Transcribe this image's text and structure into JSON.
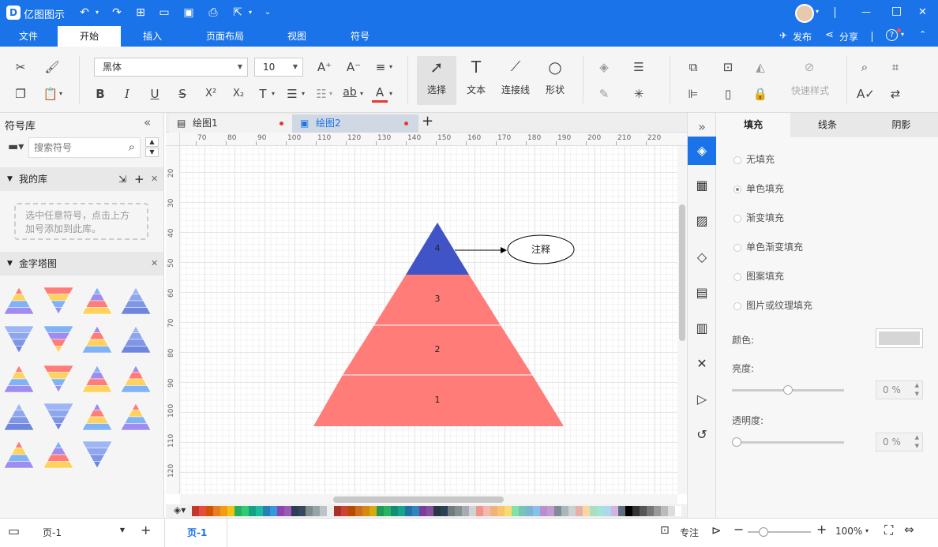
{
  "app": {
    "title": "亿图图示"
  },
  "title_actions": {
    "minimize": "—",
    "maximize": "□",
    "close": "✕"
  },
  "menu": {
    "tabs": [
      "文件",
      "开始",
      "插入",
      "页面布局",
      "视图",
      "符号"
    ],
    "active": 1,
    "publish": "发布",
    "share": "分享"
  },
  "ribbon": {
    "font_family": "黑体",
    "font_size": "10",
    "select": "选择",
    "text": "文本",
    "connector": "连接线",
    "shape": "形状",
    "quick_style": "快速样式",
    "bold": "B",
    "italic": "I",
    "underline": "U",
    "strike": "S",
    "sup": "X²",
    "sub": "X₂",
    "textfmt": "T",
    "ab": "ab",
    "fontcolor": "A"
  },
  "left_panel": {
    "title": "符号库",
    "search_placeholder": "搜索符号",
    "my_library": "我的库",
    "my_library_hint": "选中任意符号，点击上方加号添加到此库。",
    "pyramid_section": "金字塔图"
  },
  "doc_tabs": [
    {
      "label": "绘图1",
      "active": false
    },
    {
      "label": "绘图2",
      "active": true
    }
  ],
  "ruler": {
    "top": [
      "70",
      "80",
      "90",
      "100",
      "110",
      "120",
      "130",
      "140",
      "150",
      "160",
      "170",
      "180",
      "190",
      "200",
      "210",
      "220"
    ],
    "left": [
      "20",
      "30",
      "40",
      "50",
      "60",
      "70",
      "80",
      "90",
      "100",
      "110",
      "120"
    ]
  },
  "diagram": {
    "levels": [
      "4",
      "3",
      "2",
      "1"
    ],
    "annotation": "注释",
    "colors": {
      "top": "#4054c7",
      "other": "#ff7c78"
    }
  },
  "right_panel": {
    "tabs": [
      "填充",
      "线条",
      "阴影"
    ],
    "fill_options": [
      "无填充",
      "单色填充",
      "渐变填充",
      "单色渐变填充",
      "图案填充",
      "图片或纹理填充"
    ],
    "selected_fill": 1,
    "color_label": "颜色:",
    "brightness_label": "亮度:",
    "brightness_value": "0 %",
    "brightness_level": 0.5,
    "transparency_label": "透明度:",
    "transparency_value": "0 %",
    "transparency_level": 0
  },
  "status": {
    "page_select": "页-1",
    "page_tab": "页-1",
    "focus": "专注",
    "zoom": "100%"
  },
  "palette_colors": [
    "#c0392b",
    "#e74c3c",
    "#d35400",
    "#e67e22",
    "#f39c12",
    "#f1c40f",
    "#27ae60",
    "#2ecc71",
    "#16a085",
    "#1abc9c",
    "#2980b9",
    "#3498db",
    "#8e44ad",
    "#9b59b6",
    "#2c3e50",
    "#34495e",
    "#7f8c8d",
    "#95a5a6",
    "#bdc3c7",
    "#ecf0f1",
    "#a93226",
    "#cb4335",
    "#ba4a00",
    "#ca6f1e",
    "#d68910",
    "#d4ac0d",
    "#229954",
    "#28b463",
    "#138d75",
    "#17a589",
    "#2471a3",
    "#2e86c1",
    "#7d3c98",
    "#884ea0",
    "#273746",
    "#2e4053",
    "#707b7c",
    "#839192",
    "#a6acaf",
    "#d0d3d4",
    "#f1948a",
    "#f5b7b1",
    "#f0b27a",
    "#f8c471",
    "#f7dc6f",
    "#82e0aa",
    "#73c6b6",
    "#7fb3d5",
    "#85c1e9",
    "#bb8fce",
    "#c39bd3",
    "#808b96",
    "#aab7b8",
    "#ccd1d1",
    "#e6b0aa",
    "#fad7a0",
    "#a9dfbf",
    "#a3e4d7",
    "#aed6f1",
    "#d2b4de",
    "#5d6d7e",
    "#000000",
    "#333333",
    "#555555",
    "#777777",
    "#999999",
    "#bbbbbb",
    "#dddddd",
    "#ffffff"
  ]
}
